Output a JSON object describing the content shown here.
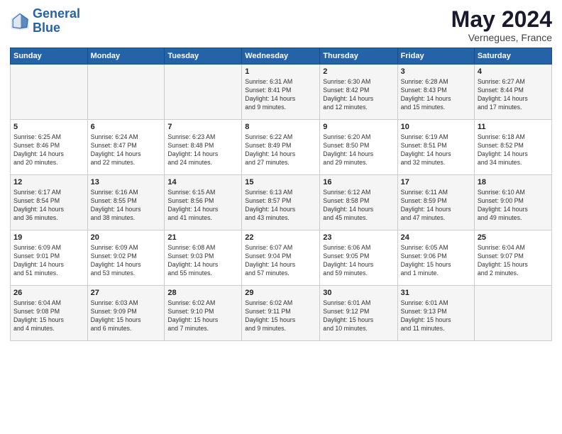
{
  "logo": {
    "part1": "General",
    "part2": "Blue"
  },
  "title": "May 2024",
  "subtitle": "Vernegues, France",
  "weekdays": [
    "Sunday",
    "Monday",
    "Tuesday",
    "Wednesday",
    "Thursday",
    "Friday",
    "Saturday"
  ],
  "weeks": [
    [
      {
        "day": "",
        "info": ""
      },
      {
        "day": "",
        "info": ""
      },
      {
        "day": "",
        "info": ""
      },
      {
        "day": "1",
        "info": "Sunrise: 6:31 AM\nSunset: 8:41 PM\nDaylight: 14 hours\nand 9 minutes."
      },
      {
        "day": "2",
        "info": "Sunrise: 6:30 AM\nSunset: 8:42 PM\nDaylight: 14 hours\nand 12 minutes."
      },
      {
        "day": "3",
        "info": "Sunrise: 6:28 AM\nSunset: 8:43 PM\nDaylight: 14 hours\nand 15 minutes."
      },
      {
        "day": "4",
        "info": "Sunrise: 6:27 AM\nSunset: 8:44 PM\nDaylight: 14 hours\nand 17 minutes."
      }
    ],
    [
      {
        "day": "5",
        "info": "Sunrise: 6:25 AM\nSunset: 8:46 PM\nDaylight: 14 hours\nand 20 minutes."
      },
      {
        "day": "6",
        "info": "Sunrise: 6:24 AM\nSunset: 8:47 PM\nDaylight: 14 hours\nand 22 minutes."
      },
      {
        "day": "7",
        "info": "Sunrise: 6:23 AM\nSunset: 8:48 PM\nDaylight: 14 hours\nand 24 minutes."
      },
      {
        "day": "8",
        "info": "Sunrise: 6:22 AM\nSunset: 8:49 PM\nDaylight: 14 hours\nand 27 minutes."
      },
      {
        "day": "9",
        "info": "Sunrise: 6:20 AM\nSunset: 8:50 PM\nDaylight: 14 hours\nand 29 minutes."
      },
      {
        "day": "10",
        "info": "Sunrise: 6:19 AM\nSunset: 8:51 PM\nDaylight: 14 hours\nand 32 minutes."
      },
      {
        "day": "11",
        "info": "Sunrise: 6:18 AM\nSunset: 8:52 PM\nDaylight: 14 hours\nand 34 minutes."
      }
    ],
    [
      {
        "day": "12",
        "info": "Sunrise: 6:17 AM\nSunset: 8:54 PM\nDaylight: 14 hours\nand 36 minutes."
      },
      {
        "day": "13",
        "info": "Sunrise: 6:16 AM\nSunset: 8:55 PM\nDaylight: 14 hours\nand 38 minutes."
      },
      {
        "day": "14",
        "info": "Sunrise: 6:15 AM\nSunset: 8:56 PM\nDaylight: 14 hours\nand 41 minutes."
      },
      {
        "day": "15",
        "info": "Sunrise: 6:13 AM\nSunset: 8:57 PM\nDaylight: 14 hours\nand 43 minutes."
      },
      {
        "day": "16",
        "info": "Sunrise: 6:12 AM\nSunset: 8:58 PM\nDaylight: 14 hours\nand 45 minutes."
      },
      {
        "day": "17",
        "info": "Sunrise: 6:11 AM\nSunset: 8:59 PM\nDaylight: 14 hours\nand 47 minutes."
      },
      {
        "day": "18",
        "info": "Sunrise: 6:10 AM\nSunset: 9:00 PM\nDaylight: 14 hours\nand 49 minutes."
      }
    ],
    [
      {
        "day": "19",
        "info": "Sunrise: 6:09 AM\nSunset: 9:01 PM\nDaylight: 14 hours\nand 51 minutes."
      },
      {
        "day": "20",
        "info": "Sunrise: 6:09 AM\nSunset: 9:02 PM\nDaylight: 14 hours\nand 53 minutes."
      },
      {
        "day": "21",
        "info": "Sunrise: 6:08 AM\nSunset: 9:03 PM\nDaylight: 14 hours\nand 55 minutes."
      },
      {
        "day": "22",
        "info": "Sunrise: 6:07 AM\nSunset: 9:04 PM\nDaylight: 14 hours\nand 57 minutes."
      },
      {
        "day": "23",
        "info": "Sunrise: 6:06 AM\nSunset: 9:05 PM\nDaylight: 14 hours\nand 59 minutes."
      },
      {
        "day": "24",
        "info": "Sunrise: 6:05 AM\nSunset: 9:06 PM\nDaylight: 15 hours\nand 1 minute."
      },
      {
        "day": "25",
        "info": "Sunrise: 6:04 AM\nSunset: 9:07 PM\nDaylight: 15 hours\nand 2 minutes."
      }
    ],
    [
      {
        "day": "26",
        "info": "Sunrise: 6:04 AM\nSunset: 9:08 PM\nDaylight: 15 hours\nand 4 minutes."
      },
      {
        "day": "27",
        "info": "Sunrise: 6:03 AM\nSunset: 9:09 PM\nDaylight: 15 hours\nand 6 minutes."
      },
      {
        "day": "28",
        "info": "Sunrise: 6:02 AM\nSunset: 9:10 PM\nDaylight: 15 hours\nand 7 minutes."
      },
      {
        "day": "29",
        "info": "Sunrise: 6:02 AM\nSunset: 9:11 PM\nDaylight: 15 hours\nand 9 minutes."
      },
      {
        "day": "30",
        "info": "Sunrise: 6:01 AM\nSunset: 9:12 PM\nDaylight: 15 hours\nand 10 minutes."
      },
      {
        "day": "31",
        "info": "Sunrise: 6:01 AM\nSunset: 9:13 PM\nDaylight: 15 hours\nand 11 minutes."
      },
      {
        "day": "",
        "info": ""
      }
    ]
  ]
}
